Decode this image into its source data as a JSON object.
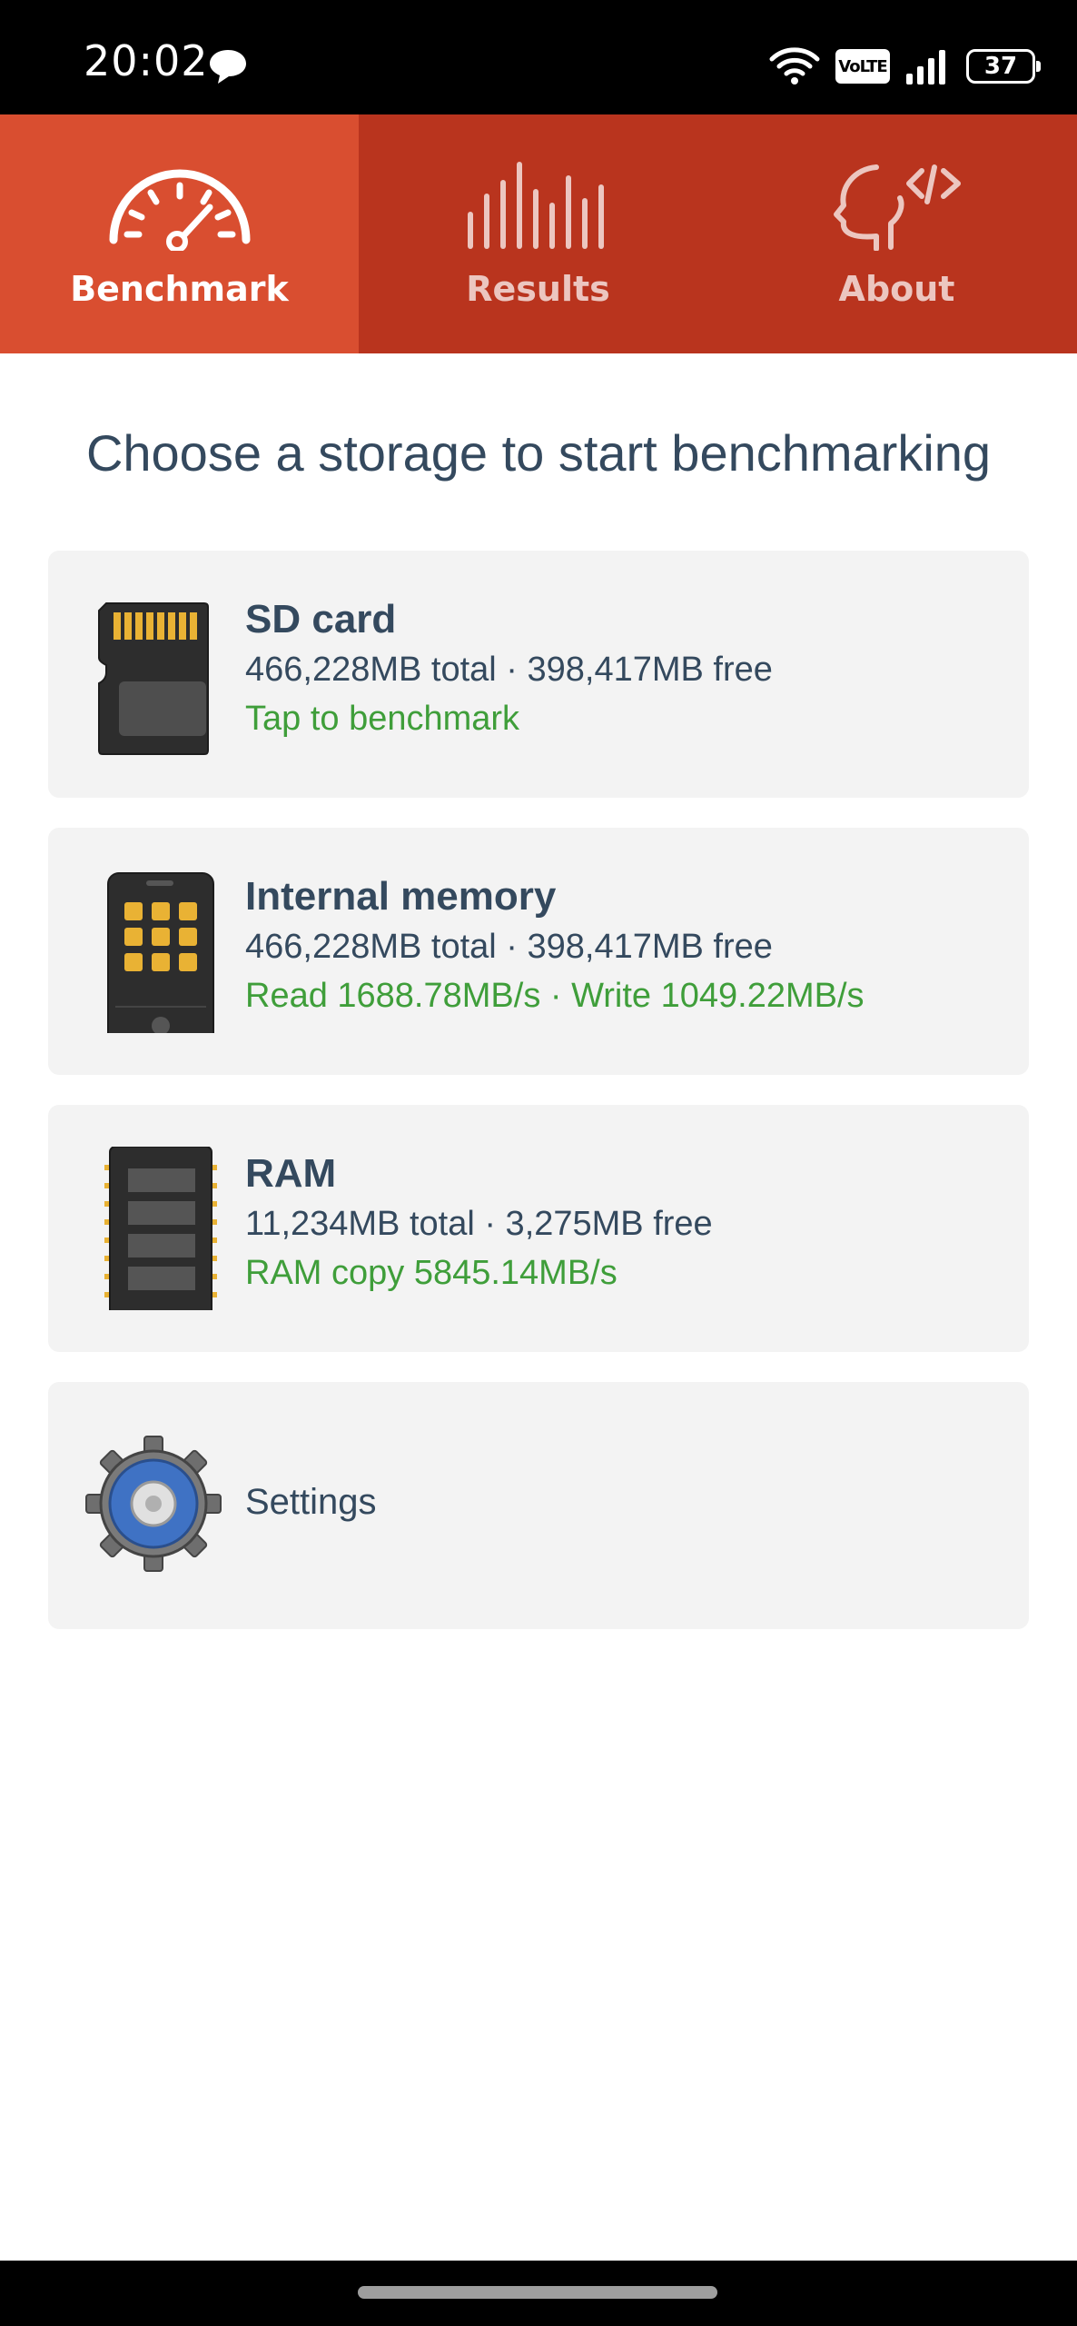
{
  "status_bar": {
    "time": "20:02",
    "network_badge": "VoLTE",
    "battery_level": "37"
  },
  "tabs": [
    {
      "label": "Benchmark",
      "icon": "speedometer-icon",
      "active": true
    },
    {
      "label": "Results",
      "icon": "bars-icon",
      "active": false
    },
    {
      "label": "About",
      "icon": "head-code-icon",
      "active": false
    }
  ],
  "main": {
    "title": "Choose a storage to start benchmarking",
    "storages": [
      {
        "title": "SD card",
        "info": "466,228MB total · 398,417MB free",
        "status": "Tap to benchmark",
        "icon": "sd-card-icon"
      },
      {
        "title": "Internal memory",
        "info": "466,228MB total · 398,417MB free",
        "status": "Read 1688.78MB/s · Write 1049.22MB/s",
        "icon": "phone-icon"
      },
      {
        "title": "RAM",
        "info": "11,234MB total · 3,275MB free",
        "status": "RAM copy 5845.14MB/s",
        "icon": "ram-chip-icon"
      }
    ],
    "settings": {
      "label": "Settings",
      "icon": "gear-icon"
    }
  },
  "colors": {
    "tab_bar": "#b9341e",
    "tab_active": "#d94e30",
    "text": "#34495e",
    "status_green": "#3f9e3a",
    "card_bg": "#f3f3f3"
  }
}
